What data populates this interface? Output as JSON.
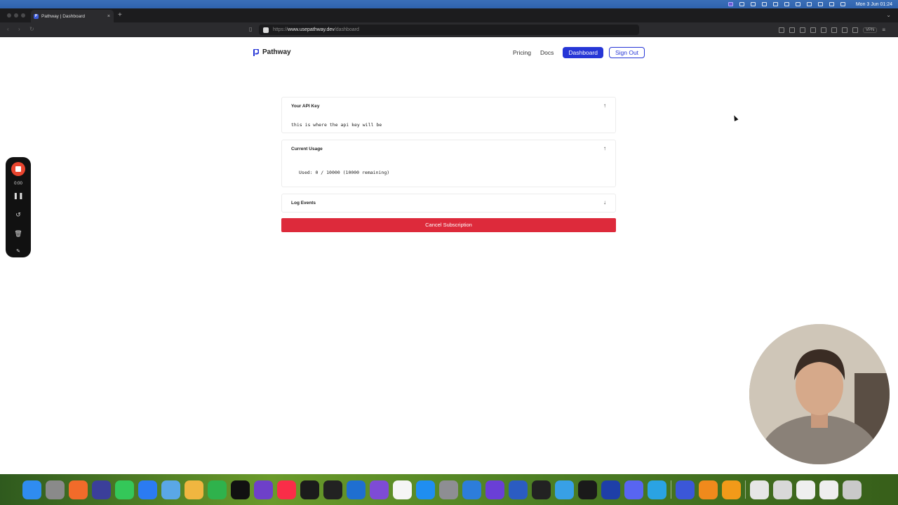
{
  "menubar": {
    "clock": "Mon 3 Jun  01:24"
  },
  "browser": {
    "tab_title": "Pathway | Dashboard",
    "url_scheme": "https://",
    "url_host": "www.usepathway.dev",
    "url_path": "/dashboard",
    "vpn_label": "VPN"
  },
  "site": {
    "brand": "Pathway",
    "nav": {
      "pricing": "Pricing",
      "docs": "Docs",
      "dashboard": "Dashboard",
      "sign_out": "Sign Out"
    }
  },
  "cards": {
    "api_key": {
      "title": "Your API Key",
      "value": "this is where the api key will be"
    },
    "usage": {
      "title": "Current Usage",
      "value": "Used: 0 / 10000 (10000 remaining)"
    },
    "logs": {
      "title": "Log Events"
    }
  },
  "cancel_label": "Cancel Subscription",
  "recorder": {
    "time": "0:00"
  },
  "dock": {
    "apps": [
      {
        "name": "finder",
        "color": "#2f8cf0"
      },
      {
        "name": "launchpad",
        "color": "#8a8a8a"
      },
      {
        "name": "brave",
        "color": "#f26b2a"
      },
      {
        "name": "affinity",
        "color": "#3b3f9a"
      },
      {
        "name": "messages",
        "color": "#34c759"
      },
      {
        "name": "mail",
        "color": "#2b7bf2"
      },
      {
        "name": "preview",
        "color": "#5aa7e6"
      },
      {
        "name": "photos",
        "color": "#f0b640"
      },
      {
        "name": "facetime",
        "color": "#2fb24c"
      },
      {
        "name": "apple-tv",
        "color": "#111111"
      },
      {
        "name": "github-desktop",
        "color": "#6e40c9"
      },
      {
        "name": "music",
        "color": "#fa2d48"
      },
      {
        "name": "pycharm",
        "color": "#1b1b1b"
      },
      {
        "name": "figma",
        "color": "#222222"
      },
      {
        "name": "vscode",
        "color": "#1f6fd1"
      },
      {
        "name": "visual-studio",
        "color": "#7e4bd6"
      },
      {
        "name": "notion",
        "color": "#f5f5f5"
      },
      {
        "name": "app-store",
        "color": "#1f8ef1"
      },
      {
        "name": "system-settings",
        "color": "#8e8e93"
      },
      {
        "name": "xcode",
        "color": "#2d7ddb"
      },
      {
        "name": "obsidian",
        "color": "#6a3fd6"
      },
      {
        "name": "word",
        "color": "#2b5cc2"
      },
      {
        "name": "terminal",
        "color": "#222222"
      },
      {
        "name": "activity",
        "color": "#38a0e6"
      },
      {
        "name": "capcut",
        "color": "#1a1a1a"
      },
      {
        "name": "app-tool",
        "color": "#1e3fa8"
      },
      {
        "name": "discord",
        "color": "#5865f2"
      },
      {
        "name": "telegram",
        "color": "#2aa3e3"
      },
      {
        "name": "spotlight-sep",
        "color": ""
      },
      {
        "name": "perplexity",
        "color": "#3b57d8"
      },
      {
        "name": "fl-studio",
        "color": "#f08a1c"
      },
      {
        "name": "pages",
        "color": "#f29a19"
      },
      {
        "name": "sep2",
        "color": ""
      },
      {
        "name": "music-file",
        "color": "#e6e6e6"
      },
      {
        "name": "document",
        "color": "#d8d8d8"
      },
      {
        "name": "document-2",
        "color": "#efefef"
      },
      {
        "name": "screenshot",
        "color": "#eeeeee"
      },
      {
        "name": "trash",
        "color": "#c9c9c9"
      }
    ]
  }
}
